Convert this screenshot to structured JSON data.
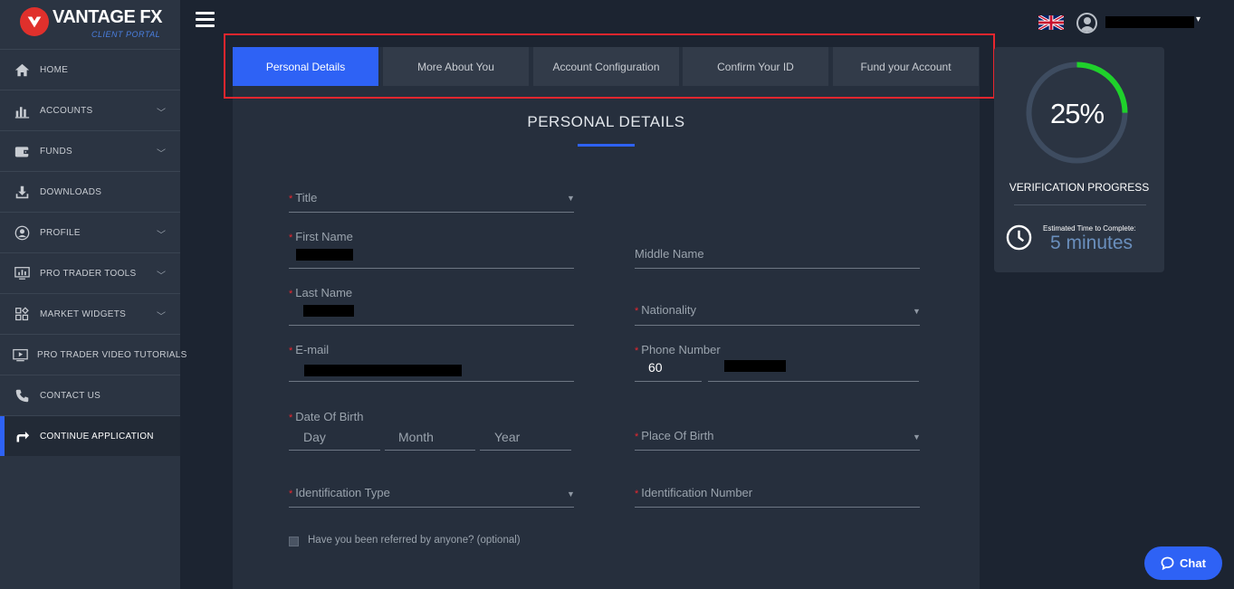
{
  "brand": {
    "name": "VANTAGE FX",
    "subtitle": "CLIENT PORTAL",
    "logo_icon": "v-logo-icon",
    "accent_color": "#2e62f5",
    "logo_color": "#e0302c"
  },
  "sidebar": {
    "items": [
      {
        "label": "HOME",
        "icon": "home-icon"
      },
      {
        "label": "ACCOUNTS",
        "icon": "bar-chart-icon",
        "expandable": true
      },
      {
        "label": "FUNDS",
        "icon": "wallet-icon",
        "expandable": true
      },
      {
        "label": "DOWNLOADS",
        "icon": "download-icon"
      },
      {
        "label": "PROFILE",
        "icon": "user-circle-icon",
        "expandable": true
      },
      {
        "label": "PRO TRADER TOOLS",
        "icon": "monitor-chart-icon",
        "expandable": true
      },
      {
        "label": "MARKET WIDGETS",
        "icon": "widgets-icon",
        "expandable": true
      },
      {
        "label": "PRO TRADER VIDEO TUTORIALS",
        "icon": "video-icon"
      },
      {
        "label": "CONTACT US",
        "icon": "phone-icon"
      },
      {
        "label": "CONTINUE APPLICATION",
        "icon": "redo-arrow-icon",
        "active": true
      }
    ]
  },
  "topbar": {
    "menu_icon": "hamburger-icon",
    "language_flag": "uk-flag-icon",
    "user_icon": "user-avatar-icon",
    "user_caret": "▾"
  },
  "steps": [
    {
      "label": "Personal Details",
      "active": true
    },
    {
      "label": "More About You"
    },
    {
      "label": "Account Configuration"
    },
    {
      "label": "Confirm Your ID"
    },
    {
      "label": "Fund your Account"
    }
  ],
  "form": {
    "section_title": "PERSONAL DETAILS",
    "required_mark": "*",
    "fields": {
      "title": {
        "label": "Title"
      },
      "first_name": {
        "label": "First Name"
      },
      "middle_name": {
        "label": "Middle Name"
      },
      "last_name": {
        "label": "Last Name"
      },
      "nationality": {
        "label": "Nationality"
      },
      "email": {
        "label": "E-mail"
      },
      "phone": {
        "label": "Phone Number",
        "country_code": "60"
      },
      "dob": {
        "label": "Date Of Birth",
        "day": "Day",
        "month": "Month",
        "year": "Year"
      },
      "place_of_birth": {
        "label": "Place Of Birth"
      },
      "id_type": {
        "label": "Identification Type"
      },
      "id_number": {
        "label": "Identification Number"
      }
    },
    "referral_checkbox": "Have you been referred by anyone? (optional)"
  },
  "progress": {
    "percent_label": "25%",
    "fraction": 0.25,
    "label": "VERIFICATION PROGRESS",
    "estimate_label": "Estimated Time to Complete:",
    "estimate_value": "5 minutes",
    "ring_color": "#1fd12b",
    "track_color": "#3e4c60"
  },
  "chat": {
    "label": "Chat",
    "icon": "chat-bubble-icon"
  }
}
